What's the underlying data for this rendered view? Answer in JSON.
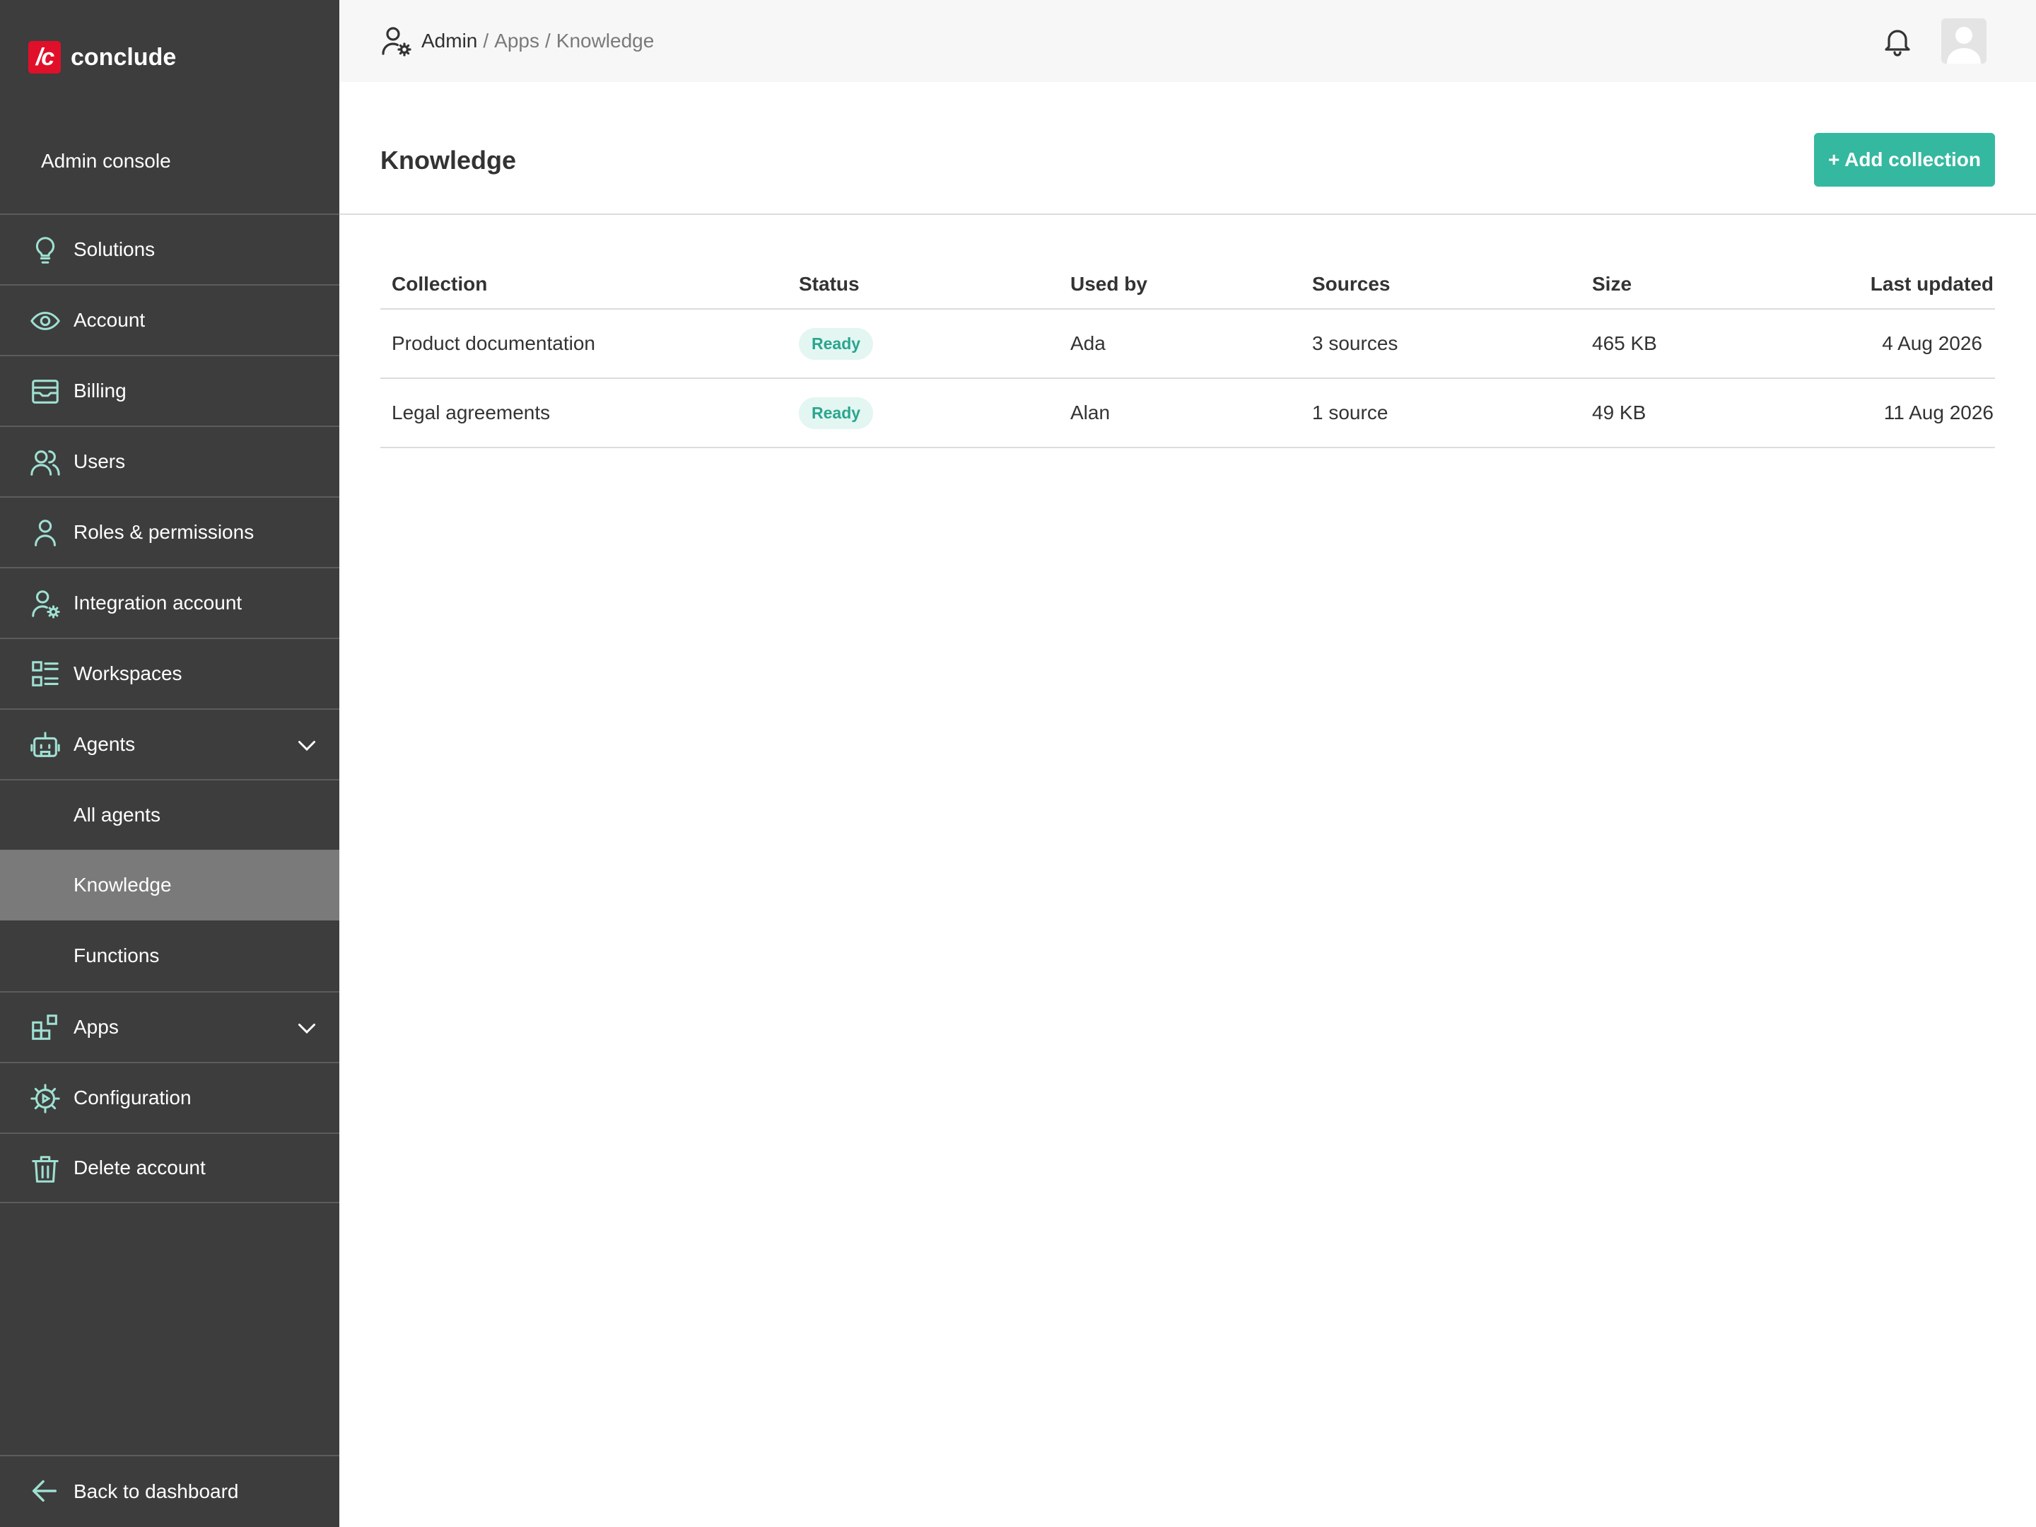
{
  "brand": {
    "logo_mark": "/c",
    "name": "conclude"
  },
  "sidebar": {
    "console_label": "Admin console",
    "items": [
      {
        "label": "Solutions",
        "icon": "lightbulb-icon"
      },
      {
        "label": "Account",
        "icon": "eye-icon"
      },
      {
        "label": "Billing",
        "icon": "billing-icon"
      },
      {
        "label": "Users",
        "icon": "users-icon"
      },
      {
        "label": "Roles & permissions",
        "icon": "person-icon"
      },
      {
        "label": "Integration account",
        "icon": "user-gear-icon"
      },
      {
        "label": "Workspaces",
        "icon": "workspaces-icon"
      },
      {
        "label": "Agents",
        "icon": "robot-icon",
        "expanded": true
      },
      {
        "label": "All agents"
      },
      {
        "label": "Knowledge",
        "active": true
      },
      {
        "label": "Functions"
      },
      {
        "label": "Apps",
        "icon": "apps-icon",
        "expanded": true
      },
      {
        "label": "Configuration",
        "icon": "gear-icon"
      },
      {
        "label": "Delete account",
        "icon": "trash-icon"
      }
    ],
    "back_label": "Back to dashboard"
  },
  "breadcrumb": {
    "root": "Admin",
    "sep": "/",
    "middle": "Apps",
    "current": "Knowledge"
  },
  "page": {
    "title": "Knowledge",
    "add_button": "+ Add collection"
  },
  "table": {
    "headers": [
      "Collection",
      "Status",
      "Used by",
      "Sources",
      "Size",
      "Last updated"
    ],
    "rows": [
      {
        "collection": "Product documentation",
        "status": "Ready",
        "used_by": "Ada",
        "sources": "3 sources",
        "size": "465 KB",
        "updated": "4 Aug 2026"
      },
      {
        "collection": "Legal agreements",
        "status": "Ready",
        "used_by": "Alan",
        "sources": "1 source",
        "size": "49 KB",
        "updated": "11 Aug 2026"
      }
    ]
  },
  "colors": {
    "sidebar": "#3d3d3d",
    "accent": "#35b8a0",
    "icon_tint": "#9fe0d2",
    "brand_red": "#e0102a",
    "active_item": "#7a7a7a"
  }
}
